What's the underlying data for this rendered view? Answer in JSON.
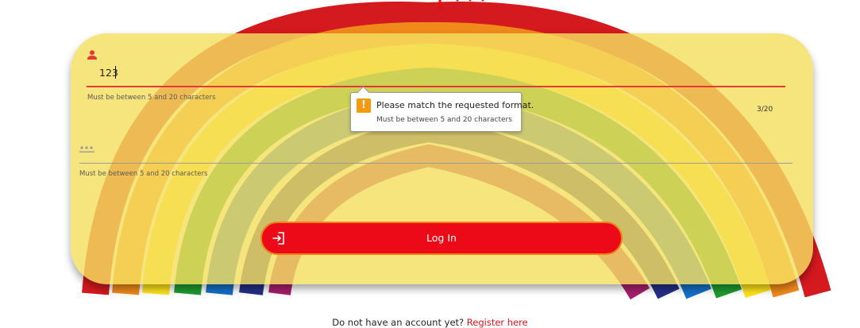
{
  "page_title": "Log in",
  "username": {
    "value": "123",
    "hint": "Must be between 5 and 20 characters",
    "counter": "3/20"
  },
  "password": {
    "placeholder": "***",
    "hint": "Must be between 5 and 20 characters"
  },
  "validation_tooltip": {
    "title": "Please match the requested format.",
    "detail": "Must be between 5 and 20 characters"
  },
  "login_button": {
    "label": "Log In"
  },
  "footer": {
    "prompt": "Do not have an account yet?",
    "link": "Register here"
  },
  "colors": {
    "card": "#f4de60",
    "button": "#ec0a19",
    "button_border": "#f07d17",
    "error_line": "#e53935",
    "warning": "#f59a0c",
    "link": "#e0141c"
  },
  "icons": {
    "username": "person-icon",
    "password": "password-dots-icon",
    "login": "login-arrow-icon",
    "warning": "warning-icon"
  }
}
